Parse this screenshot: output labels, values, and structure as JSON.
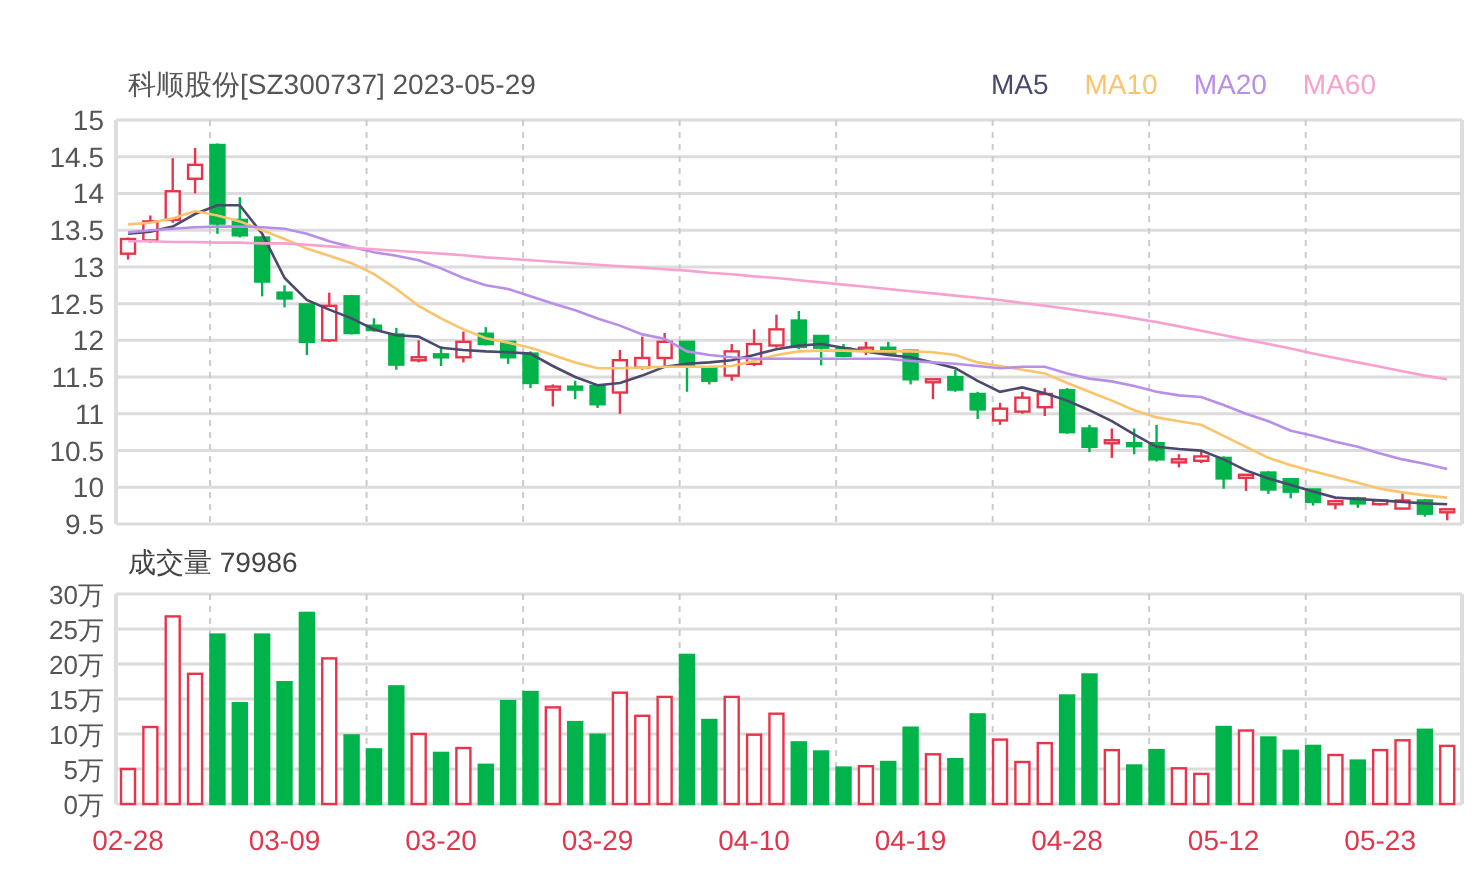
{
  "header": {
    "title": "科顺股份[SZ300737] 2023-05-29"
  },
  "price_chart": {
    "chart_data": {
      "type": "candlestick",
      "grid": true,
      "ylim": [
        9.5,
        15
      ],
      "yticks": [
        9.5,
        10,
        10.5,
        11,
        11.5,
        12,
        12.5,
        13,
        13.5,
        14,
        14.5,
        15
      ],
      "ohlc": [
        [
          13.18,
          13.4,
          13.1,
          13.38
        ],
        [
          13.36,
          13.7,
          13.33,
          13.62
        ],
        [
          13.64,
          14.48,
          13.6,
          14.03
        ],
        [
          14.2,
          14.62,
          14.0,
          14.39
        ],
        [
          14.66,
          14.68,
          13.45,
          13.59
        ],
        [
          13.64,
          13.95,
          13.4,
          13.43
        ],
        [
          13.4,
          13.42,
          12.6,
          12.8
        ],
        [
          12.65,
          12.75,
          12.45,
          12.57
        ],
        [
          12.49,
          12.5,
          11.8,
          11.98
        ],
        [
          12.0,
          12.65,
          11.98,
          12.47
        ],
        [
          12.6,
          12.62,
          12.08,
          12.1
        ],
        [
          12.2,
          12.3,
          12.12,
          12.14
        ],
        [
          12.08,
          12.17,
          11.6,
          11.67
        ],
        [
          11.75,
          12.0,
          11.7,
          11.77
        ],
        [
          11.81,
          11.92,
          11.65,
          11.78
        ],
        [
          11.77,
          12.12,
          11.7,
          11.98
        ],
        [
          12.09,
          12.18,
          11.93,
          11.95
        ],
        [
          11.98,
          11.98,
          11.68,
          11.77
        ],
        [
          11.82,
          11.85,
          11.35,
          11.42
        ],
        [
          11.35,
          11.4,
          11.1,
          11.37
        ],
        [
          11.37,
          11.45,
          11.2,
          11.35
        ],
        [
          11.38,
          11.4,
          11.08,
          11.13
        ],
        [
          11.29,
          11.87,
          11.0,
          11.73
        ],
        [
          11.63,
          12.05,
          11.6,
          11.76
        ],
        [
          11.76,
          12.1,
          11.63,
          11.98
        ],
        [
          11.98,
          11.98,
          11.3,
          11.64
        ],
        [
          11.62,
          11.65,
          11.4,
          11.45
        ],
        [
          11.52,
          11.95,
          11.45,
          11.85
        ],
        [
          11.68,
          12.15,
          11.65,
          11.95
        ],
        [
          11.93,
          12.35,
          11.9,
          12.15
        ],
        [
          12.27,
          12.4,
          11.88,
          11.91
        ],
        [
          12.06,
          12.07,
          11.66,
          11.9
        ],
        [
          11.89,
          11.95,
          11.77,
          11.79
        ],
        [
          11.88,
          11.98,
          11.8,
          11.9
        ],
        [
          11.9,
          11.98,
          11.8,
          11.82
        ],
        [
          11.86,
          11.87,
          11.4,
          11.47
        ],
        [
          11.46,
          11.47,
          11.2,
          11.47
        ],
        [
          11.5,
          11.6,
          11.3,
          11.33
        ],
        [
          11.27,
          11.3,
          10.93,
          11.06
        ],
        [
          10.91,
          11.15,
          10.85,
          11.07
        ],
        [
          11.03,
          11.3,
          11.0,
          11.22
        ],
        [
          11.09,
          11.35,
          10.97,
          11.27
        ],
        [
          11.32,
          11.35,
          10.73,
          10.75
        ],
        [
          10.8,
          10.85,
          10.48,
          10.55
        ],
        [
          10.6,
          10.8,
          10.4,
          10.64
        ],
        [
          10.6,
          10.8,
          10.45,
          10.56
        ],
        [
          10.6,
          10.85,
          10.35,
          10.38
        ],
        [
          10.36,
          10.45,
          10.27,
          10.38
        ],
        [
          10.36,
          10.48,
          10.33,
          10.42
        ],
        [
          10.4,
          10.42,
          9.98,
          10.12
        ],
        [
          10.14,
          10.17,
          9.95,
          10.17
        ],
        [
          10.2,
          10.22,
          9.91,
          9.97
        ],
        [
          10.11,
          10.12,
          9.85,
          9.94
        ],
        [
          9.97,
          9.98,
          9.75,
          9.8
        ],
        [
          9.77,
          9.83,
          9.7,
          9.81
        ],
        [
          9.85,
          9.87,
          9.72,
          9.78
        ],
        [
          9.77,
          9.84,
          9.75,
          9.82
        ],
        [
          9.71,
          9.92,
          9.7,
          9.82
        ],
        [
          9.82,
          9.84,
          9.6,
          9.64
        ],
        [
          9.67,
          9.7,
          9.55,
          9.7
        ]
      ]
    }
  },
  "moving_averages": {
    "chart_data": {
      "type": "line",
      "ylim": [
        9.5,
        15
      ],
      "series": [
        {
          "name": "MA5",
          "color": "#4b4a6e",
          "values": [
            13.45,
            13.48,
            13.55,
            13.72,
            13.84,
            13.84,
            13.45,
            12.85,
            12.55,
            12.42,
            12.3,
            12.15,
            12.07,
            12.05,
            11.9,
            11.87,
            11.85,
            11.84,
            11.82,
            11.65,
            11.5,
            11.39,
            11.42,
            11.52,
            11.64,
            11.68,
            11.7,
            11.73,
            11.8,
            11.88,
            11.93,
            11.95,
            11.9,
            11.85,
            11.8,
            11.77,
            11.7,
            11.62,
            11.45,
            11.3,
            11.36,
            11.28,
            11.18,
            11.05,
            10.9,
            10.72,
            10.55,
            10.52,
            10.5,
            10.38,
            10.23,
            10.12,
            10.03,
            9.94,
            9.86,
            9.84,
            9.82,
            9.8,
            9.78,
            9.77
          ]
        },
        {
          "name": "MA10",
          "color": "#f9c46b",
          "values": [
            13.58,
            13.6,
            13.66,
            13.76,
            13.7,
            13.62,
            13.5,
            13.38,
            13.25,
            13.15,
            13.05,
            12.9,
            12.7,
            12.47,
            12.3,
            12.15,
            12.03,
            11.97,
            11.9,
            11.8,
            11.7,
            11.62,
            11.62,
            11.63,
            11.64,
            11.64,
            11.64,
            11.65,
            11.72,
            11.8,
            11.85,
            11.86,
            11.86,
            11.85,
            11.85,
            11.85,
            11.84,
            11.8,
            11.7,
            11.65,
            11.6,
            11.55,
            11.42,
            11.3,
            11.18,
            11.05,
            10.95,
            10.9,
            10.85,
            10.7,
            10.55,
            10.4,
            10.3,
            10.22,
            10.14,
            10.06,
            9.98,
            9.93,
            9.89,
            9.86
          ]
        },
        {
          "name": "MA20",
          "color": "#b88ee8",
          "values": [
            13.47,
            13.5,
            13.52,
            13.54,
            13.55,
            13.55,
            13.54,
            13.52,
            13.45,
            13.35,
            13.27,
            13.2,
            13.15,
            13.09,
            12.98,
            12.85,
            12.75,
            12.7,
            12.6,
            12.5,
            12.41,
            12.3,
            12.2,
            12.08,
            12.02,
            11.85,
            11.8,
            11.77,
            11.75,
            11.75,
            11.75,
            11.75,
            11.75,
            11.75,
            11.75,
            11.72,
            11.7,
            11.68,
            11.65,
            11.62,
            11.64,
            11.64,
            11.55,
            11.48,
            11.44,
            11.38,
            11.3,
            11.25,
            11.23,
            11.12,
            11.0,
            10.9,
            10.77,
            10.7,
            10.62,
            10.55,
            10.46,
            10.38,
            10.32,
            10.25
          ]
        },
        {
          "name": "MA60",
          "color": "#f7a1cf",
          "values": [
            13.35,
            13.35,
            13.34,
            13.34,
            13.33,
            13.33,
            13.32,
            13.32,
            13.3,
            13.28,
            13.26,
            13.24,
            13.22,
            13.2,
            13.18,
            13.16,
            13.13,
            13.11,
            13.09,
            13.07,
            13.05,
            13.03,
            13.01,
            12.99,
            12.97,
            12.95,
            12.92,
            12.9,
            12.87,
            12.85,
            12.82,
            12.79,
            12.76,
            12.73,
            12.7,
            12.67,
            12.64,
            12.61,
            12.58,
            12.55,
            12.51,
            12.47,
            12.43,
            12.39,
            12.35,
            12.3,
            12.25,
            12.19,
            12.13,
            12.07,
            12.01,
            11.95,
            11.89,
            11.82,
            11.76,
            11.7,
            11.64,
            11.58,
            11.52,
            11.47
          ]
        }
      ]
    }
  },
  "volume_panel": {
    "chart_data": {
      "type": "bar",
      "title": "成交量 79986",
      "grid": true,
      "ylim": [
        0,
        30
      ],
      "yticks": [
        {
          "value": 0,
          "label": "0万"
        },
        {
          "value": 5,
          "label": "5万"
        },
        {
          "value": 10,
          "label": "10万"
        },
        {
          "value": 15,
          "label": "15万"
        },
        {
          "value": 20,
          "label": "20万"
        },
        {
          "value": 25,
          "label": "25万"
        },
        {
          "value": 30,
          "label": "30万"
        }
      ],
      "categories": [
        "02-28",
        null,
        null,
        null,
        null,
        null,
        null,
        "03-09",
        null,
        null,
        null,
        null,
        null,
        null,
        "03-20",
        null,
        null,
        null,
        null,
        null,
        null,
        "03-29",
        null,
        null,
        null,
        null,
        null,
        null,
        "04-10",
        null,
        null,
        null,
        null,
        null,
        null,
        "04-19",
        null,
        null,
        null,
        null,
        null,
        null,
        "04-28",
        null,
        null,
        null,
        null,
        null,
        null,
        "05-12",
        null,
        null,
        null,
        null,
        null,
        null,
        "05-23",
        null,
        null,
        null
      ],
      "values": [
        5.0,
        11.0,
        26.8,
        18.6,
        24.2,
        14.4,
        24.2,
        17.4,
        27.3,
        20.8,
        9.8,
        7.8,
        16.8,
        10.0,
        7.3,
        8.0,
        5.6,
        14.7,
        16.0,
        13.8,
        11.7,
        9.9,
        15.9,
        12.6,
        15.3,
        21.3,
        12.0,
        15.3,
        9.9,
        12.9,
        8.8,
        7.5,
        5.2,
        5.4,
        6.0,
        10.9,
        7.1,
        6.4,
        12.8,
        9.2,
        6.0,
        8.7,
        15.5,
        18.5,
        7.7,
        5.5,
        7.7,
        5.1,
        4.3,
        11.0,
        10.5,
        9.5,
        7.6,
        8.3,
        7.0,
        6.2,
        7.7,
        9.1,
        10.6,
        8.3
      ]
    }
  }
}
